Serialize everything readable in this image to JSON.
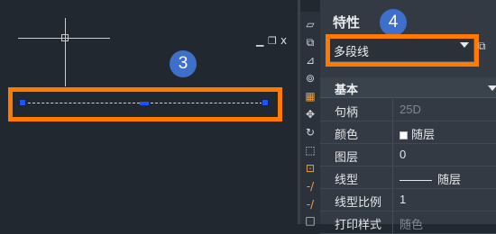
{
  "window_controls": {
    "minimize": "▁",
    "restore": "❐",
    "close": "x"
  },
  "annotations": {
    "badge_3": "3",
    "badge_4": "4",
    "highlight_color": "#ff7a00",
    "badge_color": "#3d6fcb"
  },
  "toolbar": {
    "icons": [
      "eraser-icon",
      "copy-icon",
      "mirror-icon",
      "offset-icon",
      "array-icon",
      "move-icon",
      "rotate-icon",
      "scale-icon",
      "stretch-icon",
      "trim-icon",
      "extend-icon",
      "break-icon"
    ]
  },
  "properties": {
    "title": "特性",
    "selected_type": "多段线",
    "section": "基本",
    "rows": [
      {
        "label": "句柄",
        "value": "25D",
        "dim": true
      },
      {
        "label": "颜色",
        "value": "随层",
        "swatch": "#ffffff"
      },
      {
        "label": "图层",
        "value": "0"
      },
      {
        "label": "线型",
        "value": "随层",
        "line": true
      },
      {
        "label": "线型比例",
        "value": "1"
      },
      {
        "label": "打印样式",
        "value": "随色",
        "dim": true
      }
    ]
  }
}
